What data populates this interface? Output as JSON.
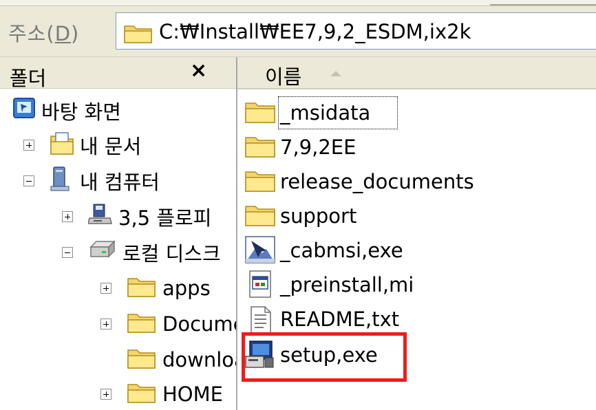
{
  "address_bar": {
    "label": "주소(",
    "label_key": "D",
    "label_end": ")",
    "path": "C:₩Install₩EE7,9,2_ESDM,ix2k",
    "icon": "folder-icon"
  },
  "folder_pane": {
    "title": "폴더",
    "close": "×",
    "tree": [
      {
        "label": "바탕 화면",
        "icon": "desktop-icon"
      },
      {
        "label": "내 문서",
        "icon": "my-documents-icon",
        "expander": "plus"
      },
      {
        "label": "내 컴퓨터",
        "icon": "my-computer-icon",
        "expander": "minus"
      },
      {
        "label": "3,5 플로피",
        "icon": "floppy-drive-icon",
        "expander": "plus"
      },
      {
        "label": "로컬 디스크",
        "icon": "local-disk-icon",
        "expander": "minus"
      },
      {
        "label": "apps",
        "icon": "folder-icon",
        "expander": "plus"
      },
      {
        "label": "Documents",
        "icon": "folder-icon",
        "expander": "plus"
      },
      {
        "label": "download",
        "icon": "folder-icon"
      },
      {
        "label": "HOME",
        "icon": "folder-icon",
        "expander": "plus"
      }
    ]
  },
  "file_pane": {
    "column_name": "이름",
    "files": [
      {
        "name": "_msidata",
        "icon": "folder-icon"
      },
      {
        "name": "7,9,2EE",
        "icon": "folder-icon"
      },
      {
        "name": "release_documents",
        "icon": "folder-icon"
      },
      {
        "name": "support",
        "icon": "folder-icon"
      },
      {
        "name": "_cabmsi,exe",
        "icon": "installer-exe-icon"
      },
      {
        "name": "_preinstall,mi",
        "icon": "script-file-icon"
      },
      {
        "name": "README,txt",
        "icon": "text-file-icon"
      },
      {
        "name": "setup,exe",
        "icon": "setup-exe-icon"
      }
    ]
  },
  "colors": {
    "highlight": "#ee1c1c",
    "folder": "#f5d56a",
    "chrome": "#ece9d8"
  }
}
